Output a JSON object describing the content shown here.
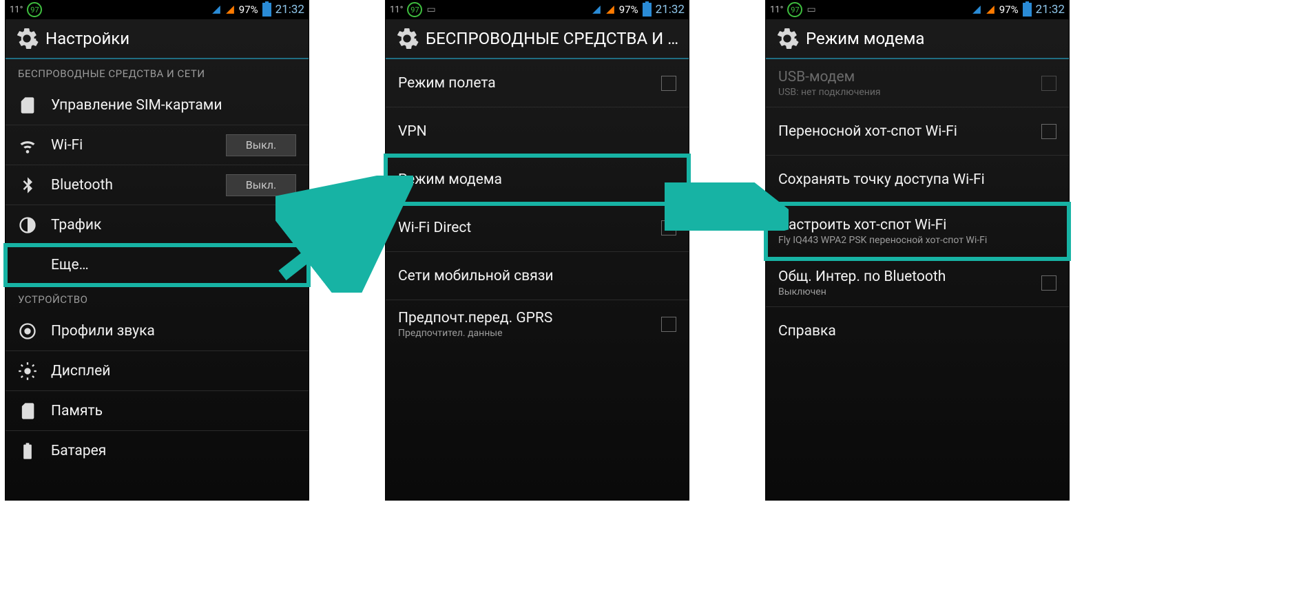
{
  "statusbar": {
    "temp": "11°",
    "badge": "97",
    "pct": "97%",
    "time": "21:32"
  },
  "screen1": {
    "title": "Настройки",
    "section_wireless": "БЕСПРОВОДНЫЕ СРЕДСТВА И СЕТИ",
    "sim": "Управление SIM-картами",
    "wifi": "Wi-Fi",
    "wifi_tog": "Выкл.",
    "bt": "Bluetooth",
    "bt_tog": "Выкл.",
    "traffic": "Трафик",
    "more": "Еще…",
    "section_device": "УСТРОЙСТВО",
    "sound": "Профили звука",
    "display": "Дисплей",
    "storage": "Память",
    "battery": "Батарея"
  },
  "screen2": {
    "title": "БЕСПРОВОДНЫЕ СРЕДСТВА И СЕ…",
    "airplane": "Режим полета",
    "vpn": "VPN",
    "tether": "Режим модема",
    "wifidir": "Wi-Fi Direct",
    "mobile": "Сети мобильной связи",
    "gprs": "Предпочт.перед. GPRS",
    "gprs_sub": "Предпочтител. данные"
  },
  "screen3": {
    "title": "Режим модема",
    "usb": "USB-модем",
    "usb_sub": "USB: нет подключения",
    "hotspot": "Переносной хот-спот Wi-Fi",
    "keep": "Сохранять точку доступа Wi-Fi",
    "conf": "Настроить хот-спот Wi-Fi",
    "conf_sub": "Fly IQ443 WPA2 PSK переносной хот-спот Wi-Fi",
    "btshare": "Общ. Интер. по Bluetooth",
    "btshare_sub": "Выключен",
    "help": "Справка"
  }
}
